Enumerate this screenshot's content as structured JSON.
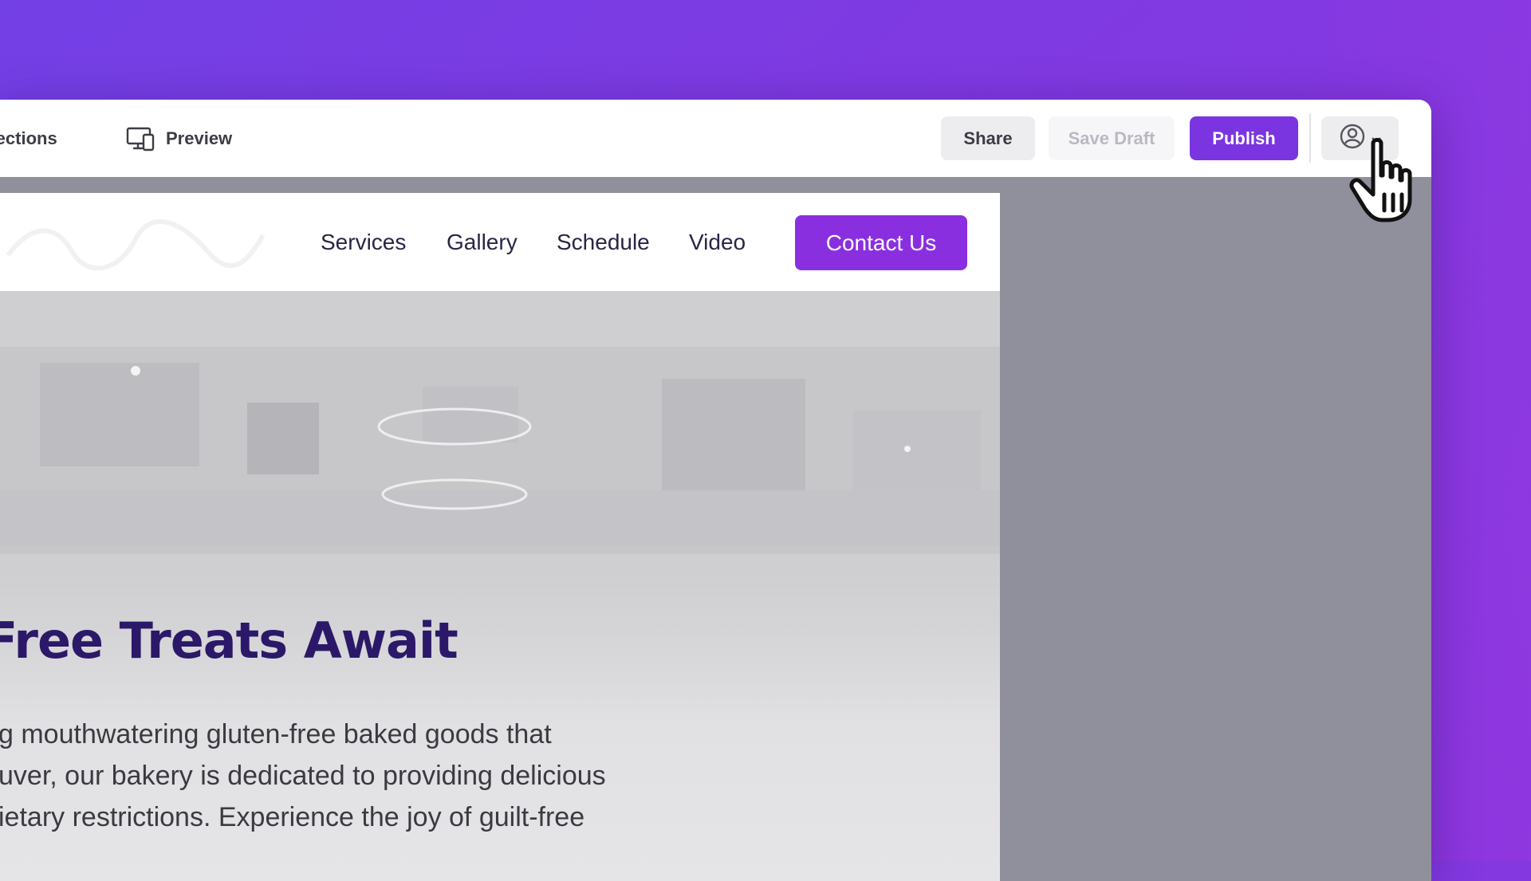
{
  "toolbar": {
    "sections_label": "Sections",
    "preview_label": "Preview",
    "share_label": "Share",
    "save_draft_label": "Save Draft",
    "publish_label": "Publish",
    "account_icon": "user-circle-icon",
    "account_chevron": "chevron-down-icon"
  },
  "site": {
    "nav": {
      "links": [
        "Services",
        "Gallery",
        "Schedule",
        "Video"
      ],
      "cta_label": "Contact Us"
    },
    "hero": {
      "title": "Free Treats Await",
      "text_lines": [
        "g mouthwatering gluten-free baked goods that",
        "uver, our bakery is dedicated to providing delicious",
        "ietary restrictions. Experience the joy of guilt-free"
      ]
    }
  },
  "colors": {
    "background": "#7a3ce4",
    "accent": "#7a35e0",
    "cta": "#8a2fe0",
    "canvas": "#8f909c",
    "hero_title": "#2c1868"
  }
}
